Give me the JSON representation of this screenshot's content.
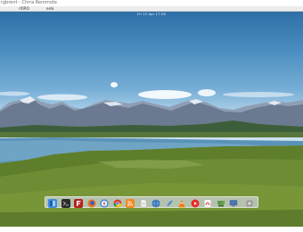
{
  "window": {
    "title": "rgbrent - Chrra Remmote"
  },
  "menu": {
    "items": [
      "rlORO",
      "eela"
    ]
  },
  "desktop": {
    "clock": "Fri 15 Apr 17:56"
  },
  "dock": {
    "items": [
      {
        "name": "finder",
        "color": "#3c8be0"
      },
      {
        "name": "terminal",
        "color": "#2b2b2b"
      },
      {
        "name": "filezilla",
        "color": "#b5211e"
      },
      {
        "name": "firefox",
        "color": "#e8741f"
      },
      {
        "name": "safari",
        "color": "#2374d8"
      },
      {
        "name": "chrome",
        "color": "#ffffff"
      },
      {
        "name": "rss",
        "color": "#f08a24"
      },
      {
        "name": "document",
        "color": "#f4f4f4"
      },
      {
        "name": "globe",
        "color": "#2d6fb8"
      },
      {
        "name": "feather",
        "color": "#3f7fc7"
      },
      {
        "name": "vlc",
        "color": "#f07f00"
      },
      {
        "name": "youtube",
        "color": "#e52d27"
      },
      {
        "name": "pdf-reader",
        "color": "#d12b2b"
      },
      {
        "name": "network-drive",
        "color": "#5a9a45"
      },
      {
        "name": "monitor",
        "color": "#4a78b5"
      },
      {
        "name": "add",
        "color": "#8c8c8c"
      }
    ]
  }
}
